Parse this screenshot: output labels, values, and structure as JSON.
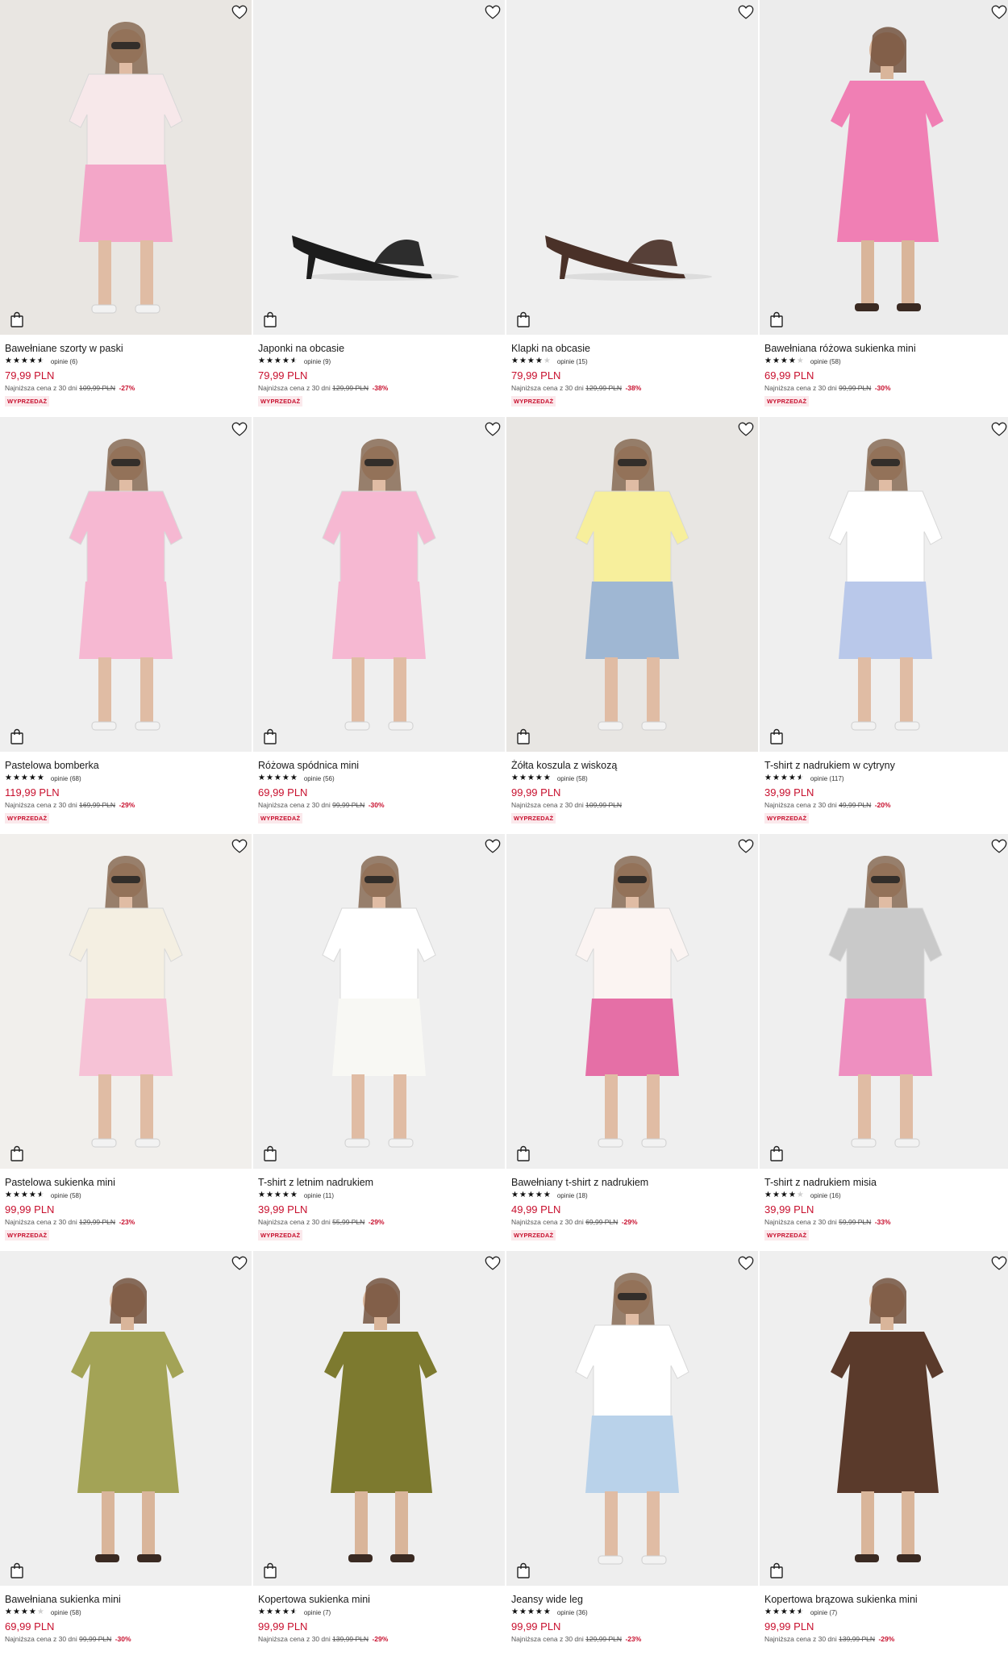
{
  "colors": {
    "accent": "#c8102e",
    "badge_bg": "#fbe9ec",
    "star": "#111111"
  },
  "products": [
    {
      "title": "Bawełniane szorty w paski",
      "rating": 4.5,
      "reviews": "opinie (6)",
      "price": "79,99 PLN",
      "lowest_prefix": "Najniższa cena z 30 dni",
      "lowest_price": "109,99 PLN",
      "discount": "-27%",
      "badge": "WYPRZEDAŻ",
      "scene": {
        "bg": "#e9e6e2",
        "garment": "#f3a6c8",
        "top": "#f7e8ea",
        "type": "outfit"
      }
    },
    {
      "title": "Japonki na obcasie",
      "rating": 4.5,
      "reviews": "opinie (9)",
      "price": "79,99 PLN",
      "lowest_prefix": "Najniższa cena z 30 dni",
      "lowest_price": "129,99 PLN",
      "discount": "-38%",
      "badge": "WYPRZEDAŻ",
      "scene": {
        "bg": "#efefef",
        "garment": "#1c1c1c",
        "type": "shoe"
      }
    },
    {
      "title": "Klapki na obcasie",
      "rating": 4,
      "reviews": "opinie (15)",
      "price": "79,99 PLN",
      "lowest_prefix": "Najniższa cena z 30 dni",
      "lowest_price": "129,99 PLN",
      "discount": "-38%",
      "badge": "WYPRZEDAŻ",
      "scene": {
        "bg": "#efefef",
        "garment": "#4a3128",
        "type": "shoe"
      }
    },
    {
      "title": "Bawełniana różowa sukienka mini",
      "rating": 4,
      "reviews": "opinie (58)",
      "price": "69,99 PLN",
      "lowest_prefix": "Najniższa cena z 30 dni",
      "lowest_price": "99,99 PLN",
      "discount": "-30%",
      "badge": "WYPRZEDAŻ",
      "scene": {
        "bg": "#ececec",
        "garment": "#f07fb4",
        "type": "dress"
      }
    },
    {
      "title": "Pastelowa bomberka",
      "rating": 5,
      "reviews": "opinie (68)",
      "price": "119,99 PLN",
      "lowest_prefix": "Najniższa cena z 30 dni",
      "lowest_price": "169,99 PLN",
      "discount": "-29%",
      "badge": "WYPRZEDAŻ",
      "scene": {
        "bg": "#efefef",
        "garment": "#f6b8d2",
        "top": "#f6b8d2",
        "type": "outfit"
      }
    },
    {
      "title": "Różowa spódnica mini",
      "rating": 5,
      "reviews": "opinie (56)",
      "price": "69,99 PLN",
      "lowest_prefix": "Najniższa cena z 30 dni",
      "lowest_price": "99,99 PLN",
      "discount": "-30%",
      "badge": "WYPRZEDAŻ",
      "scene": {
        "bg": "#efefef",
        "garment": "#f6b8d2",
        "top": "#f6b8d2",
        "type": "outfit"
      }
    },
    {
      "title": "Żółta koszula z wiskozą",
      "rating": 5,
      "reviews": "opinie (58)",
      "price": "99,99 PLN",
      "lowest_prefix": "Najniższa cena z 30 dni",
      "lowest_price": "109,99 PLN",
      "discount": "",
      "badge": "WYPRZEDAŻ",
      "scene": {
        "bg": "#e8e6e3",
        "garment": "#9fb7d3",
        "top": "#f7ef9c",
        "type": "outfit"
      }
    },
    {
      "title": "T-shirt z nadrukiem w cytryny",
      "rating": 4.5,
      "reviews": "opinie (117)",
      "price": "39,99 PLN",
      "lowest_prefix": "Najniższa cena z 30 dni",
      "lowest_price": "49,99 PLN",
      "discount": "-20%",
      "badge": "WYPRZEDAŻ",
      "scene": {
        "bg": "#efefef",
        "garment": "#b9c8ea",
        "top": "#ffffff",
        "type": "outfit"
      }
    },
    {
      "title": "Pastelowa sukienka mini",
      "rating": 4.5,
      "reviews": "opinie (58)",
      "price": "99,99 PLN",
      "lowest_prefix": "Najniższa cena z 30 dni",
      "lowest_price": "129,99 PLN",
      "discount": "-23%",
      "badge": "WYPRZEDAŻ",
      "scene": {
        "bg": "#f1efec",
        "garment": "#f6c2d6",
        "top": "#f4efe2",
        "type": "outfit"
      }
    },
    {
      "title": "T-shirt z letnim nadrukiem",
      "rating": 5,
      "reviews": "opinie (11)",
      "price": "39,99 PLN",
      "lowest_prefix": "Najniższa cena z 30 dni",
      "lowest_price": "55,99 PLN",
      "discount": "-29%",
      "badge": "WYPRZEDAŻ",
      "scene": {
        "bg": "#efefef",
        "garment": "#f8f8f4",
        "top": "#ffffff",
        "type": "outfit"
      }
    },
    {
      "title": "Bawełniany t-shirt z nadrukiem",
      "rating": 5,
      "reviews": "opinie (18)",
      "price": "49,99 PLN",
      "lowest_prefix": "Najniższa cena z 30 dni",
      "lowest_price": "69,99 PLN",
      "discount": "-29%",
      "badge": "WYPRZEDAŻ",
      "scene": {
        "bg": "#efefef",
        "garment": "#e56fa6",
        "top": "#fbf4f2",
        "type": "outfit"
      }
    },
    {
      "title": "T-shirt z nadrukiem misia",
      "rating": 4,
      "reviews": "opinie (16)",
      "price": "39,99 PLN",
      "lowest_prefix": "Najniższa cena z 30 dni",
      "lowest_price": "59,99 PLN",
      "discount": "-33%",
      "badge": "WYPRZEDAŻ",
      "scene": {
        "bg": "#efefef",
        "garment": "#ee8fc0",
        "top": "#c9c9c9",
        "type": "outfit"
      }
    },
    {
      "title": "Bawełniana sukienka mini",
      "rating": 4,
      "reviews": "opinie (58)",
      "price": "69,99 PLN",
      "lowest_prefix": "Najniższa cena z 30 dni",
      "lowest_price": "99,99 PLN",
      "discount": "-30%",
      "badge": "",
      "scene": {
        "bg": "#efefef",
        "garment": "#a3a356",
        "type": "dress"
      }
    },
    {
      "title": "Kopertowa sukienka mini",
      "rating": 4.5,
      "reviews": "opinie (7)",
      "price": "99,99 PLN",
      "lowest_prefix": "Najniższa cena z 30 dni",
      "lowest_price": "139,99 PLN",
      "discount": "-29%",
      "badge": "",
      "scene": {
        "bg": "#efefef",
        "garment": "#7d7a2f",
        "type": "dress"
      }
    },
    {
      "title": "Jeansy wide leg",
      "rating": 5,
      "reviews": "opinie (36)",
      "price": "99,99 PLN",
      "lowest_prefix": "Najniższa cena z 30 dni",
      "lowest_price": "129,99 PLN",
      "discount": "-23%",
      "badge": "",
      "scene": {
        "bg": "#eeeeee",
        "garment": "#b9d2ea",
        "top": "#ffffff",
        "type": "outfit"
      }
    },
    {
      "title": "Kopertowa brązowa sukienka mini",
      "rating": 4.5,
      "reviews": "opinie (7)",
      "price": "99,99 PLN",
      "lowest_prefix": "Najniższa cena z 30 dni",
      "lowest_price": "139,99 PLN",
      "discount": "-29%",
      "badge": "",
      "scene": {
        "bg": "#efefef",
        "garment": "#5a3a2b",
        "type": "dress"
      }
    }
  ]
}
